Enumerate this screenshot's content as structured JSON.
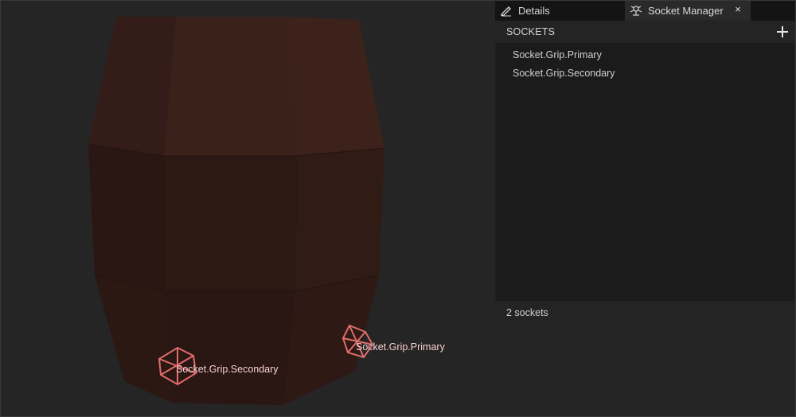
{
  "tabs": {
    "details_label": "Details",
    "socket_manager_label": "Socket Manager",
    "close_symbol": "×"
  },
  "panel": {
    "header_title": "SOCKETS",
    "add_icon": "plus-icon",
    "items": [
      {
        "label": "Socket.Grip.Primary"
      },
      {
        "label": "Socket.Grip.Secondary"
      }
    ],
    "footer_count": "2 sockets"
  },
  "viewport": {
    "sockets": [
      {
        "label": "Socket.Grip.Secondary"
      },
      {
        "label": "Socket.Grip.Primary"
      }
    ],
    "socket_color": "#e06666",
    "barrel_color": "#3a1f18"
  }
}
